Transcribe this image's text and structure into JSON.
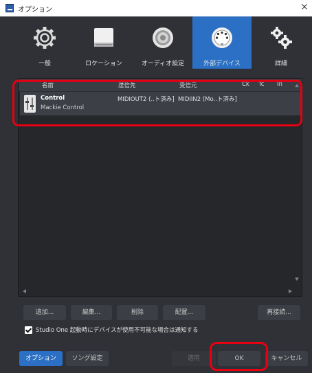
{
  "window": {
    "title": "オプション",
    "close_glyph": "×"
  },
  "toolbar": {
    "tabs": [
      {
        "label": "一般",
        "icon": "gear-icon",
        "active": false
      },
      {
        "label": "ロケーション",
        "icon": "drive-icon",
        "active": false
      },
      {
        "label": "オーディオ設定",
        "icon": "speaker-icon",
        "active": false
      },
      {
        "label": "外部デバイス",
        "icon": "midi-connector-icon",
        "active": true
      },
      {
        "label": "詳細",
        "icon": "gears-icon",
        "active": false
      }
    ]
  },
  "device_table": {
    "columns": [
      "名前",
      "送信先",
      "受信元",
      "Ck",
      "Tc",
      "In"
    ],
    "rows": [
      {
        "name": "Control",
        "model": "Mackie Control",
        "send_to": "MIDIOUT2 (..ト済み]",
        "receive_from": "MIDIIN2 (Mo..ト済み]"
      }
    ]
  },
  "actions": {
    "add": "追加...",
    "edit": "編集...",
    "delete": "削除",
    "arrange": "配置...",
    "reconnect": "再接続..."
  },
  "notify_checkbox": {
    "label": "Studio One 起動時にデバイスが使用不可能な場合は通知する",
    "checked": true
  },
  "footer": {
    "options": "オプション",
    "song_settings": "ソング設定",
    "apply": "適用",
    "ok": "OK",
    "cancel": "キャンセル"
  },
  "colors": {
    "accent": "#2b70c4",
    "highlight": "#e60012",
    "background": "#2f3136"
  }
}
